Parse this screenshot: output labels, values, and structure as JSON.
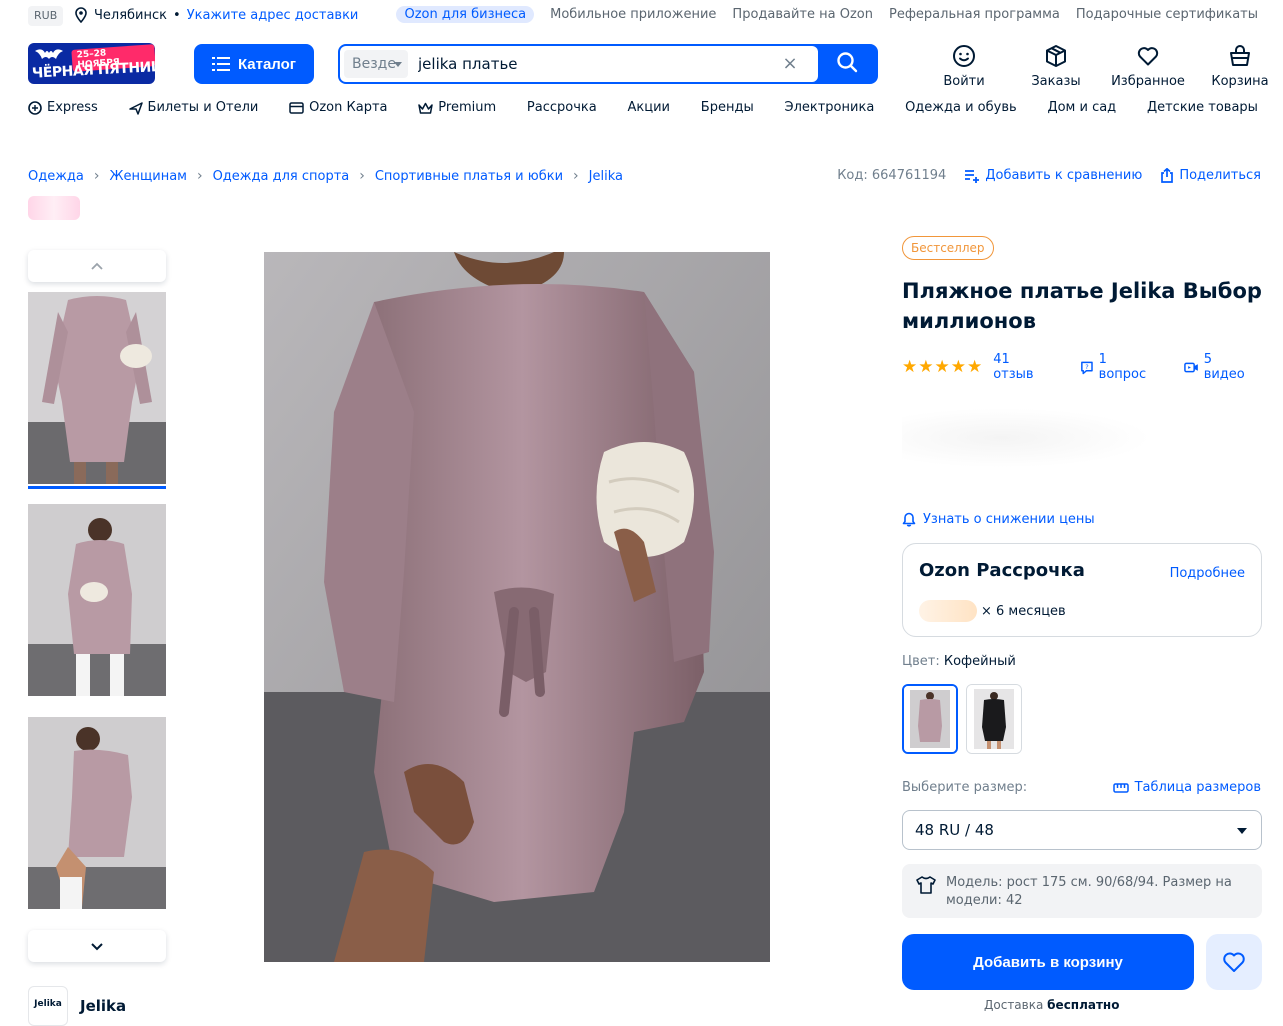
{
  "topline": {
    "currency": "RUB",
    "city": "Челябинск",
    "address_link": "Укажите адрес доставки",
    "links": [
      "Ozon для бизнеса",
      "Мобильное приложение",
      "Продавайте на Ozon",
      "Реферальная программа",
      "Подарочные сертификаты"
    ]
  },
  "header": {
    "promo_date": "25–28 НОЯБРЯ",
    "promo_text": "ЧЁРНАЯ ПЯТНИЦА",
    "catalog_label": "Каталог",
    "search_scope": "Везде",
    "search_value": "jelika платье",
    "icons": [
      {
        "label": "Войти",
        "icon": "face-icon"
      },
      {
        "label": "Заказы",
        "icon": "box-icon"
      },
      {
        "label": "Избранное",
        "icon": "heart-icon"
      },
      {
        "label": "Корзина",
        "icon": "basket-icon"
      }
    ]
  },
  "nav": [
    "Express",
    "Билеты и Отели",
    "Ozon Карта",
    "Premium",
    "Рассрочка",
    "Акции",
    "Бренды",
    "Электроника",
    "Одежда и обувь",
    "Дом и сад",
    "Детские товары"
  ],
  "breadcrumbs": [
    "Одежда",
    "Женщинам",
    "Одежда для спорта",
    "Спортивные платья и юбки",
    "Jelika"
  ],
  "product": {
    "code": "Код: 664761194",
    "compare": "Добавить к сравнению",
    "share": "Поделиться",
    "badge": "Бестселлер",
    "title": "Пляжное платье Jelika Выбор миллионов",
    "rating_stars": 4.5,
    "reviews": "41 отзыв",
    "questions": "1 вопрос",
    "videos": "5 видео",
    "price_notify": "Узнать о снижении цены",
    "installment_title": "Ozon Рассрочка",
    "installment_more": "Подробнее",
    "installment_months": "× 6 месяцев",
    "color_label": "Цвет:",
    "color_value": "Кофейный",
    "size_label": "Выберите размер:",
    "size_table": "Таблица размеров",
    "size_value": "48 RU / 48",
    "model_info": "Модель: рост 175 см. 90/68/94. Размер на модели: 42",
    "add_to_cart": "Добавить в корзину",
    "delivery_prefix": "Доставка",
    "delivery_value": "бесплатно",
    "brand_name": "Jelika",
    "brand_logo_text": "Jelika"
  },
  "colors": {
    "accent": "#005bff",
    "badge": "#f1963a",
    "stars": "#ffa800"
  }
}
